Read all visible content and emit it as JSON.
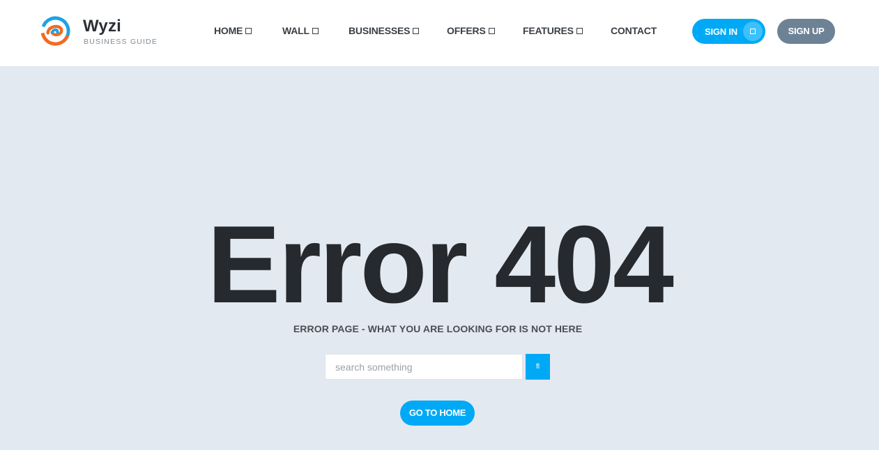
{
  "brand": {
    "name": "Wyzi",
    "tagline": "BUSINESS GUIDE",
    "logo_icon": "swirl-logo-icon",
    "colors": {
      "orange": "#f26a21",
      "blue": "#1ea3e4"
    }
  },
  "nav": {
    "items": [
      {
        "label": "HOME",
        "icon": "chevron-down-icon"
      },
      {
        "label": "WALL",
        "icon": "chevron-down-icon"
      },
      {
        "label": "BUSINESSES",
        "icon": "chevron-down-icon"
      },
      {
        "label": "OFFERS",
        "icon": "chevron-down-icon"
      },
      {
        "label": "FEATURES",
        "icon": "chevron-down-icon"
      },
      {
        "label": "CONTACT"
      }
    ]
  },
  "auth": {
    "sign_in_label": "SIGN IN",
    "sign_in_icon": "user-icon",
    "sign_up_label": "SIGN UP"
  },
  "error": {
    "title": "Error 404",
    "subtitle": "ERROR PAGE - WHAT YOU ARE LOOKING FOR IS NOT HERE"
  },
  "search": {
    "placeholder": "search something",
    "value": "",
    "button_glyph": "fl",
    "button_icon": "search-icon"
  },
  "home_button_label": "GO TO HOME",
  "colors": {
    "accent": "#00a9f6",
    "signup_bg": "#6e8296",
    "page_bg": "#e3e9f1",
    "title": "#26292d"
  }
}
